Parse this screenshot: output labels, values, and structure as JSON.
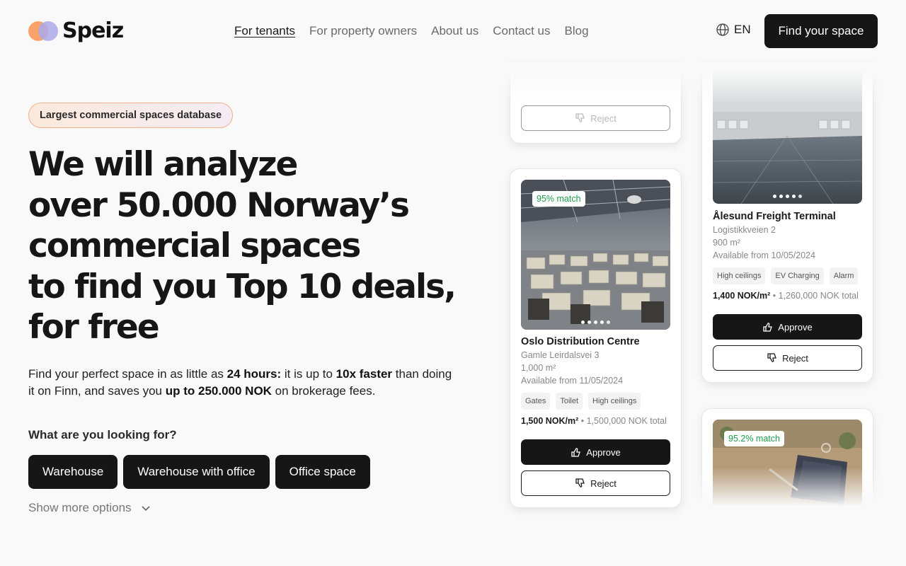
{
  "header": {
    "logo_text": "Speiz",
    "nav": [
      {
        "label": "For tenants"
      },
      {
        "label": "For property owners"
      },
      {
        "label": "About us"
      },
      {
        "label": "Contact us"
      },
      {
        "label": "Blog"
      }
    ],
    "language": "EN",
    "cta_label": "Find your space"
  },
  "hero": {
    "badge": "Largest commercial spaces database",
    "headline_lines": [
      "We will analyze",
      "over 50.000 Norway’s",
      "commercial spaces",
      "to find you Top 10 deals,",
      "for free"
    ],
    "sub": {
      "p1": "Find your perfect space in as little as ",
      "b1": "24 hours:",
      "p2": " it is up to ",
      "b2": "10x faster",
      "p3": " than doing it on Finn, and saves you ",
      "b3": "up to 250.000 NOK",
      "p4": " on brokerage fees."
    },
    "question": "What are you looking for?",
    "options": [
      "Warehouse",
      "Warehouse with office",
      "Office space"
    ],
    "show_more": "Show more options"
  },
  "cards": {
    "top_left": {
      "reject_label": "Reject"
    },
    "oslo": {
      "match": "95% match",
      "title": "Oslo Distribution Centre",
      "address": "Gamle Leirdalsvei 3",
      "size": "1,000 m²",
      "available": "Available from 11/05/2024",
      "tags": [
        "Gates",
        "Toilet",
        "High ceilings"
      ],
      "price_per": "1,500 NOK/m²",
      "price_total": "1,500,000 NOK total",
      "approve_label": "Approve",
      "reject_label": "Reject"
    },
    "alesund": {
      "title": "Ålesund Freight Terminal",
      "address": "Logistikkveien 2",
      "size": "900 m²",
      "available": "Available from 10/05/2024",
      "tags": [
        "High ceilings",
        "EV Charging",
        "Alarm"
      ],
      "price_per": "1,400 NOK/m²",
      "price_total": "1,260,000 NOK total",
      "approve_label": "Approve",
      "reject_label": "Reject"
    },
    "bottom_right": {
      "match": "95.2% match"
    }
  },
  "colors": {
    "primary_dark": "#161616",
    "match_green": "#1e9d4a",
    "badge_border": "#f1b08a"
  }
}
